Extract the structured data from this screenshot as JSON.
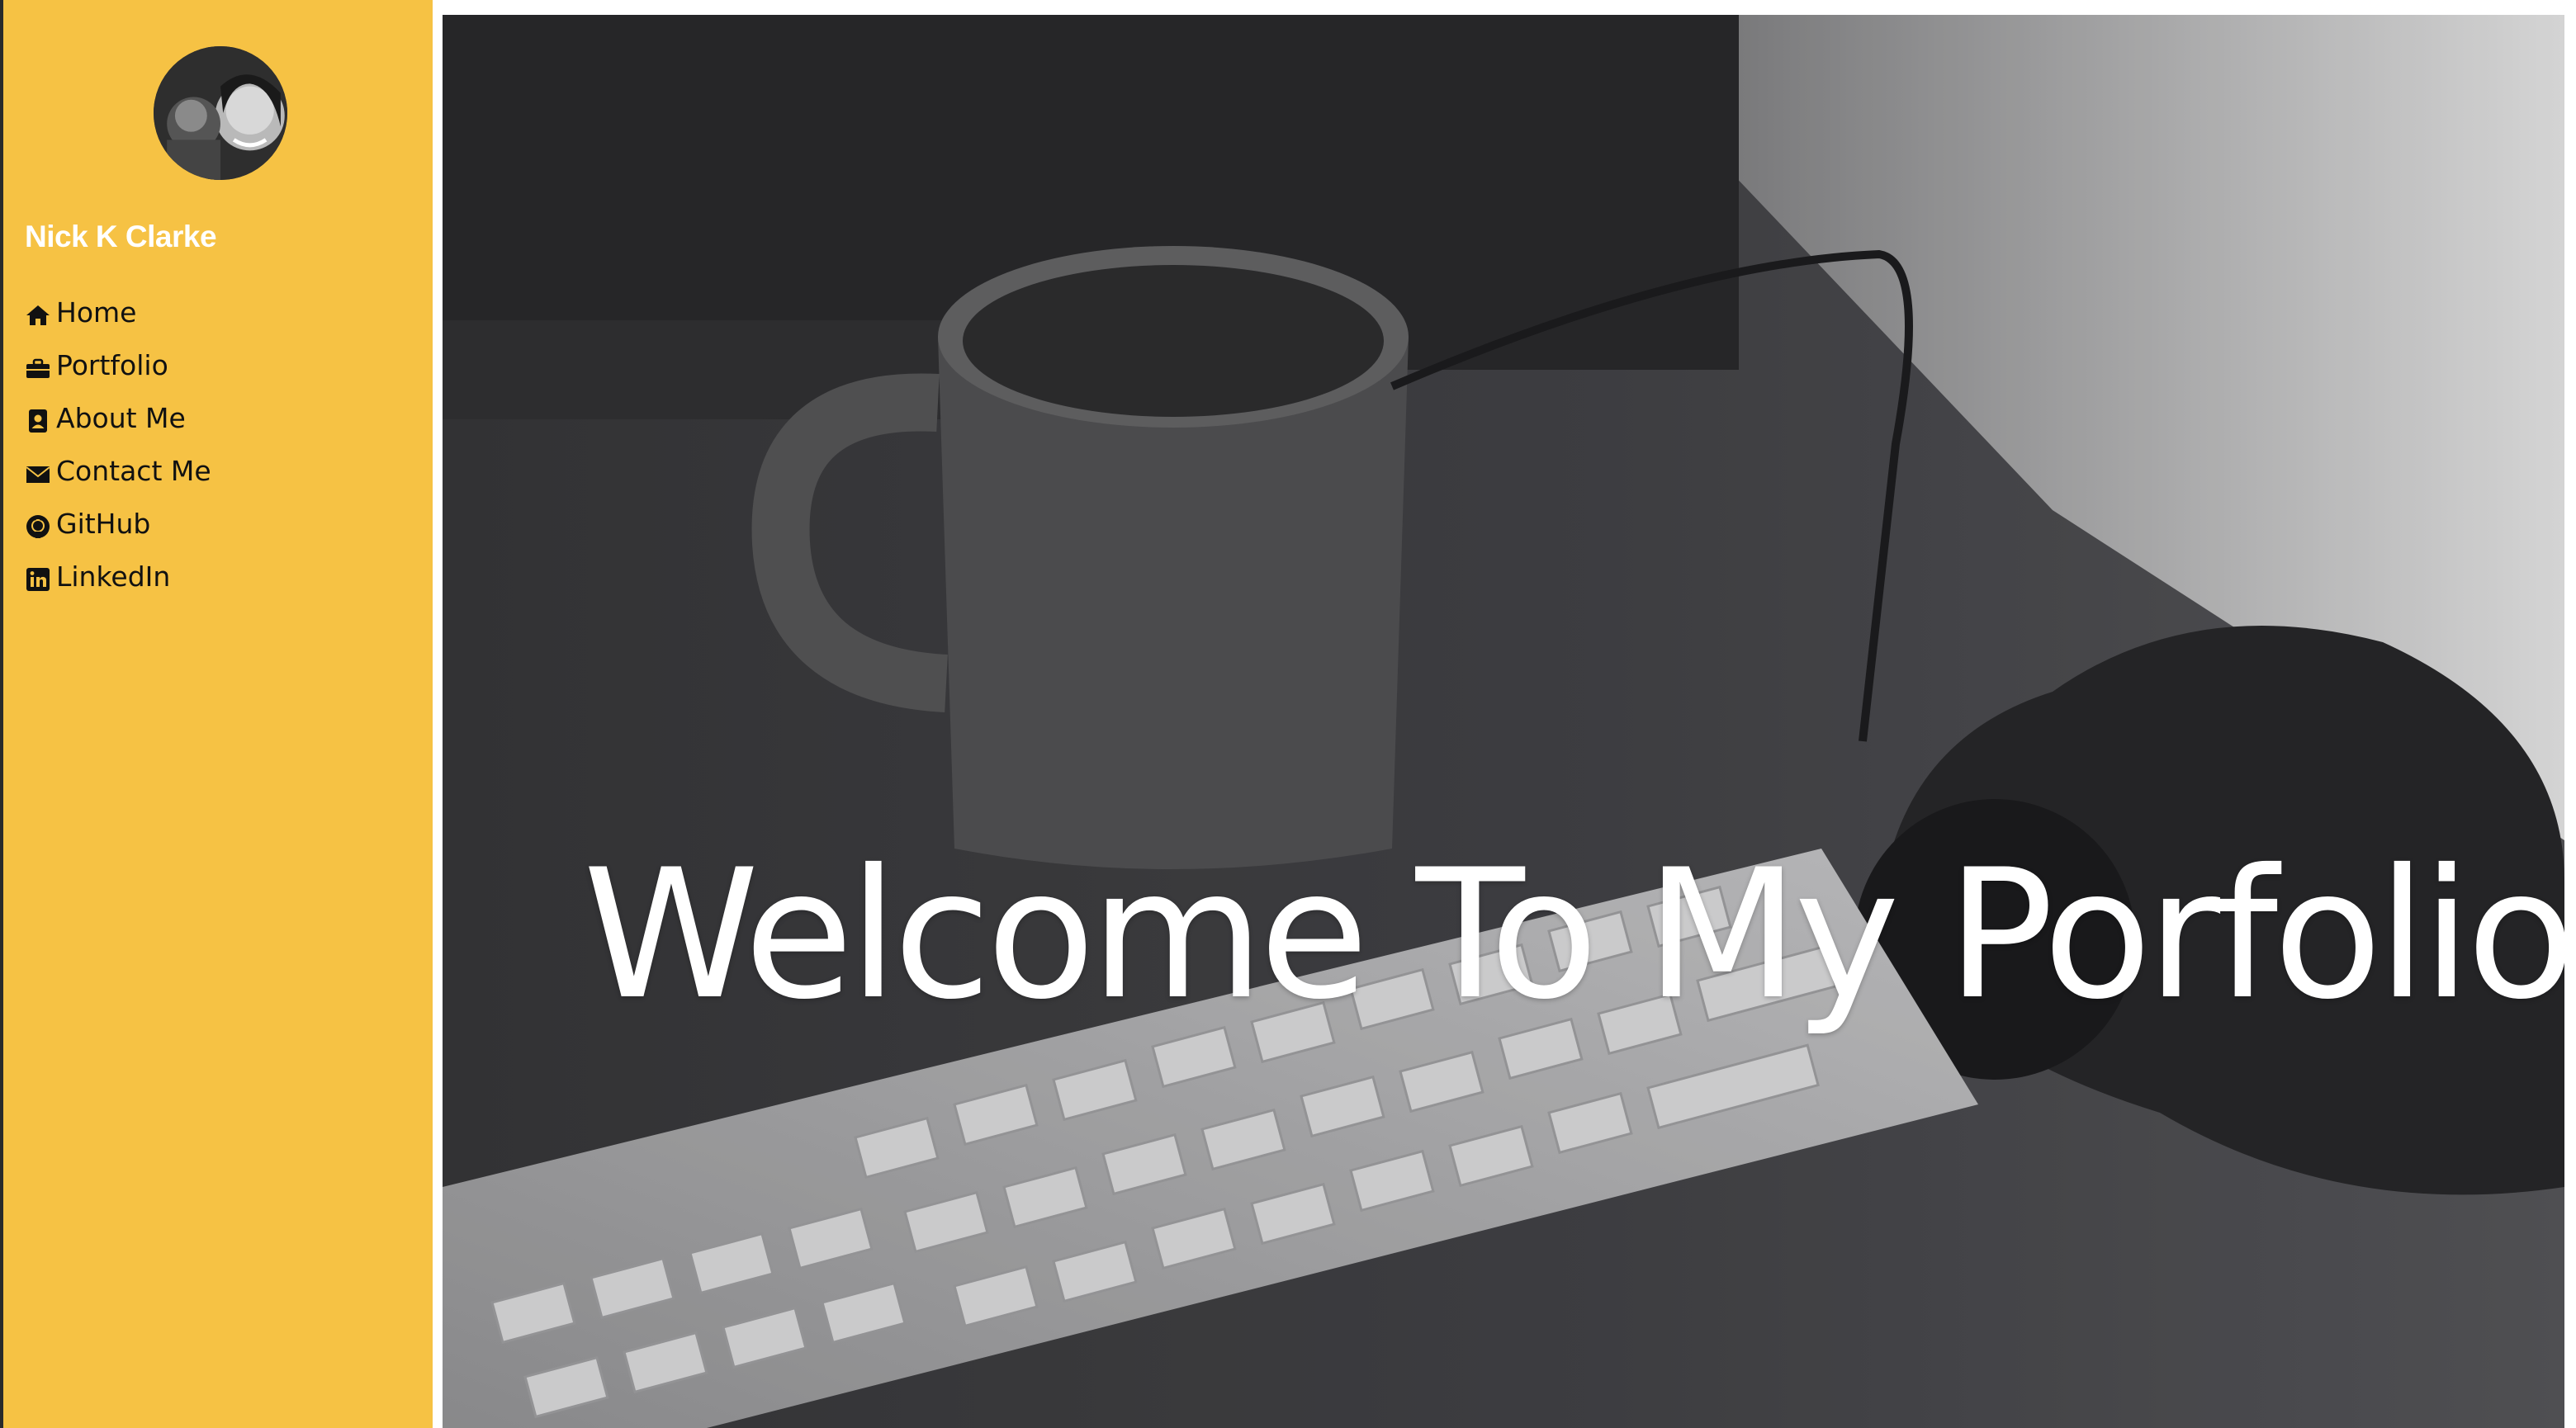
{
  "sidebar": {
    "brand": "Nick K Clarke",
    "items": [
      {
        "label": "Home",
        "icon": "home-icon"
      },
      {
        "label": "Portfolio",
        "icon": "briefcase-icon"
      },
      {
        "label": "About Me",
        "icon": "contact-card-icon"
      },
      {
        "label": "Contact Me",
        "icon": "envelope-icon"
      },
      {
        "label": "GitHub",
        "icon": "github-icon"
      },
      {
        "label": "LinkedIn",
        "icon": "linkedin-icon"
      }
    ]
  },
  "hero": {
    "title": "Welcome To My Porfolio"
  },
  "colors": {
    "sidebar_bg": "#f6c244",
    "brand_text": "#ffffff",
    "nav_text": "#111111",
    "hero_overlay": "#3a3a3c"
  }
}
